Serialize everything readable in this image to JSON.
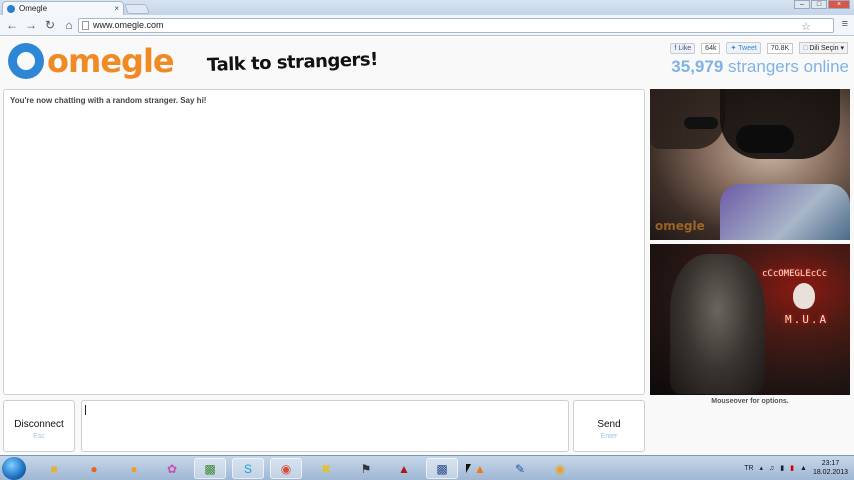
{
  "browser": {
    "tab_title": "Omegle",
    "tab_close": "×",
    "url": "www.omegle.com",
    "window_buttons": [
      "–",
      "□",
      "×"
    ]
  },
  "header": {
    "logo_text": "omegle",
    "tagline": "Talk to strangers!",
    "like_label": "Like",
    "like_count": "64k",
    "tweet_label": "Tweet",
    "tweet_count": "70.8K",
    "lang_label": "Dili Seçin",
    "online_count": "35,979",
    "online_label": "strangers online"
  },
  "chat": {
    "status_message": "You're now chatting with a random stranger. Say hi!"
  },
  "video": {
    "stranger_watermark": "omegle",
    "self_neon_title": "cCcOMEGLEcCc",
    "self_neon_sub": "M.U.A",
    "mouseover_hint": "Mouseover for options."
  },
  "controls": {
    "disconnect_label": "Disconnect",
    "disconnect_hint": "Esc",
    "send_label": "Send",
    "send_hint": "Enter",
    "message_value": ""
  },
  "taskbar": {
    "language": "TR",
    "time": "23:17",
    "date": "18.02.2013",
    "icons": [
      "windows-explorer",
      "firefox",
      "media-player",
      "picasa",
      "network",
      "skype",
      "chrome",
      "norton",
      "counter-strike",
      "avatar-app",
      "save-app",
      "vlc",
      "microphone",
      "avast"
    ]
  },
  "colors": {
    "omegle_orange": "#f08a24",
    "omegle_blue": "#2e86d6",
    "online_blue": "#7fb2e5"
  }
}
